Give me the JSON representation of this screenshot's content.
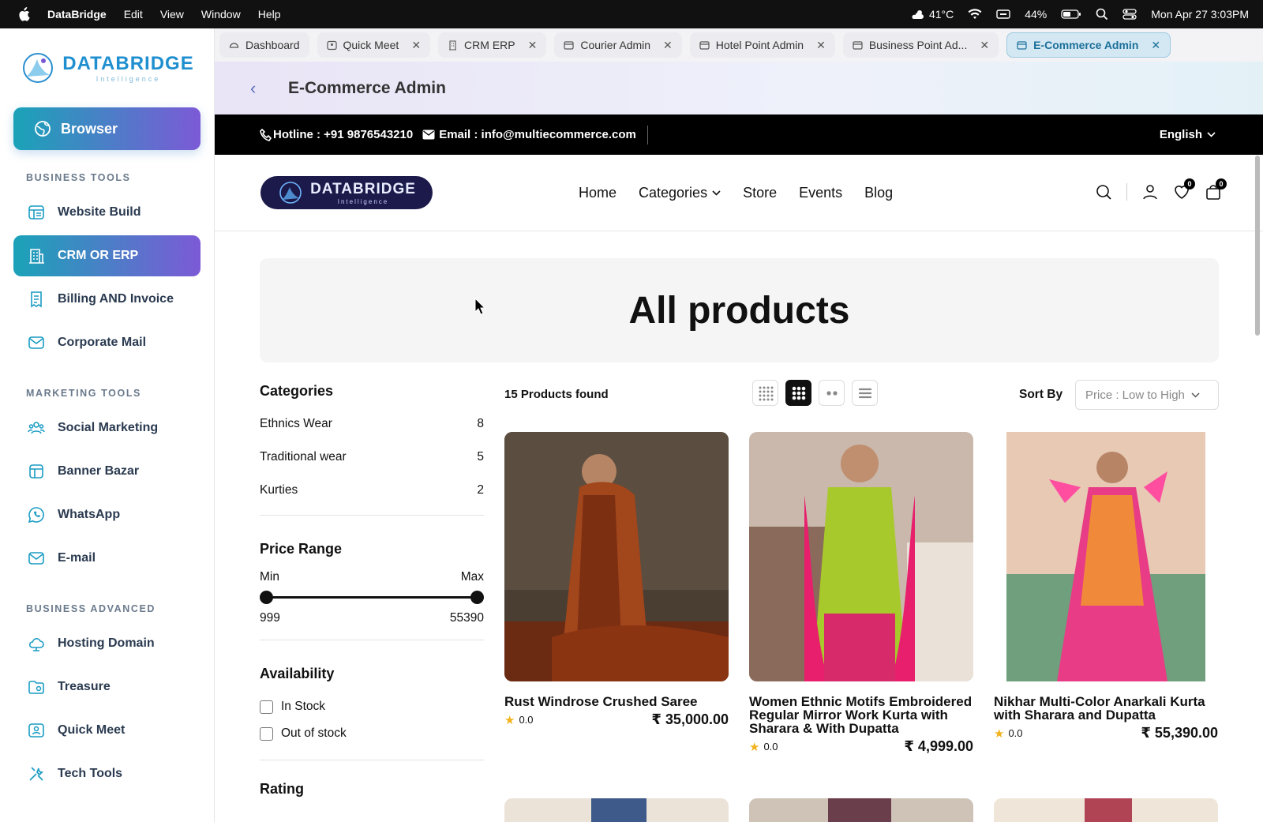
{
  "menubar": {
    "app": "DataBridge",
    "items": [
      "Edit",
      "View",
      "Window",
      "Help"
    ],
    "weather": "41°C",
    "battery": "44%",
    "datetime": "Mon Apr 27  3:03PM"
  },
  "sidebar": {
    "logo_text": "DATABRIDGE",
    "logo_sub": "Intelligence",
    "browser_label": "Browser",
    "sections": [
      {
        "title": "BUSINESS TOOLS",
        "items": [
          "Website Build",
          "CRM OR ERP",
          "Billing AND  Invoice",
          "Corporate Mail"
        ]
      },
      {
        "title": "MARKETING TOOLS",
        "items": [
          "Social Marketing",
          "Banner Bazar",
          "WhatsApp",
          "E-mail"
        ]
      },
      {
        "title": "BUSINESS ADVANCED",
        "items": [
          "Hosting Domain",
          "Treasure",
          "Quick Meet",
          "Tech Tools"
        ]
      }
    ]
  },
  "tabs": [
    "Dashboard",
    "Quick Meet",
    "CRM ERP",
    "Courier Admin",
    "Hotel Point Admin",
    "Business Point Ad...",
    "E-Commerce Admin"
  ],
  "app_header": {
    "title": "E-Commerce Admin"
  },
  "store": {
    "hotline": "Hotline : +91 9876543210",
    "email": "Email : info@multiecommerce.com",
    "language": "English",
    "logo_text": "DATABRIDGE",
    "logo_sub": "Intelligence",
    "menu": [
      "Home",
      "Categories",
      "Store",
      "Events",
      "Blog"
    ],
    "wishlist_count": "0",
    "cart_count": "0",
    "hero_title": "All products",
    "filters": {
      "categories_title": "Categories",
      "categories": [
        {
          "name": "Ethnics Wear",
          "count": "8"
        },
        {
          "name": "Traditional wear",
          "count": "5"
        },
        {
          "name": "Kurties",
          "count": "2"
        }
      ],
      "price_title": "Price Range",
      "min_label": "Min",
      "max_label": "Max",
      "min_value": "999",
      "max_value": "55390",
      "availability_title": "Availability",
      "in_stock": "In Stock",
      "out_of_stock": "Out of stock",
      "rating_title": "Rating"
    },
    "products_found": "15 Products found",
    "sort_label": "Sort By",
    "sort_value": "Price : Low to High",
    "products": [
      {
        "name": "Rust Windrose Crushed Saree",
        "rating": "0.0",
        "price": "₹ 35,000.00"
      },
      {
        "name": "Women Ethnic Motifs Embroidered Regular Mirror Work Kurta with Sharara & With Dupatta",
        "rating": "0.0",
        "price": "₹ 4,999.00"
      },
      {
        "name": "Nikhar Multi-Color Anarkali Kurta with Sharara and Dupatta",
        "rating": "0.0",
        "price": "₹ 55,390.00"
      }
    ]
  }
}
